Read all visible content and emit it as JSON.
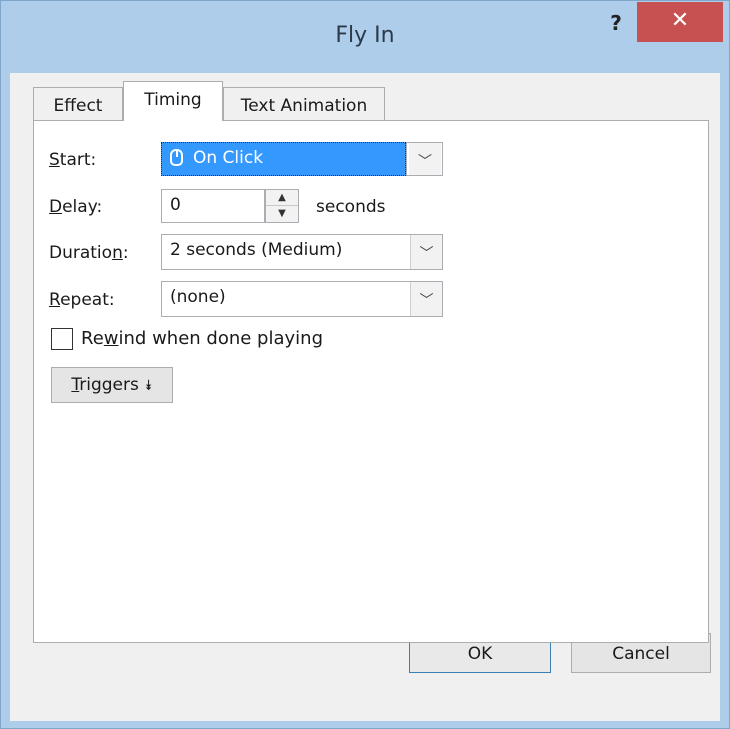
{
  "window": {
    "title": "Fly In",
    "help_glyph": "?",
    "close_glyph": "✕"
  },
  "tabs": [
    {
      "label": "Effect",
      "active": false
    },
    {
      "label": "Timing",
      "active": true
    },
    {
      "label": "Text Animation",
      "active": false
    }
  ],
  "timing": {
    "start": {
      "label_u": "S",
      "label_rest": "tart:",
      "value": "On Click",
      "icon": "mouse-icon"
    },
    "delay": {
      "label_u": "D",
      "label_rest": "elay:",
      "value": "0",
      "unit": "seconds"
    },
    "duration": {
      "label_pre": "Duratio",
      "label_u": "n",
      "label_post": ":",
      "value": "2 seconds (Medium)"
    },
    "repeat": {
      "label_u": "R",
      "label_rest": "epeat:",
      "value": "(none)"
    },
    "rewind": {
      "label_pre": "Re",
      "label_u": "w",
      "label_post": "ind when done playing",
      "checked": false
    },
    "triggers": {
      "label_u": "T",
      "label_rest": "riggers",
      "glyph": "⯯"
    }
  },
  "buttons": {
    "ok": "OK",
    "cancel": "Cancel"
  },
  "colors": {
    "frame": "#aecdea",
    "close": "#c75050",
    "selection": "#3399ff"
  }
}
